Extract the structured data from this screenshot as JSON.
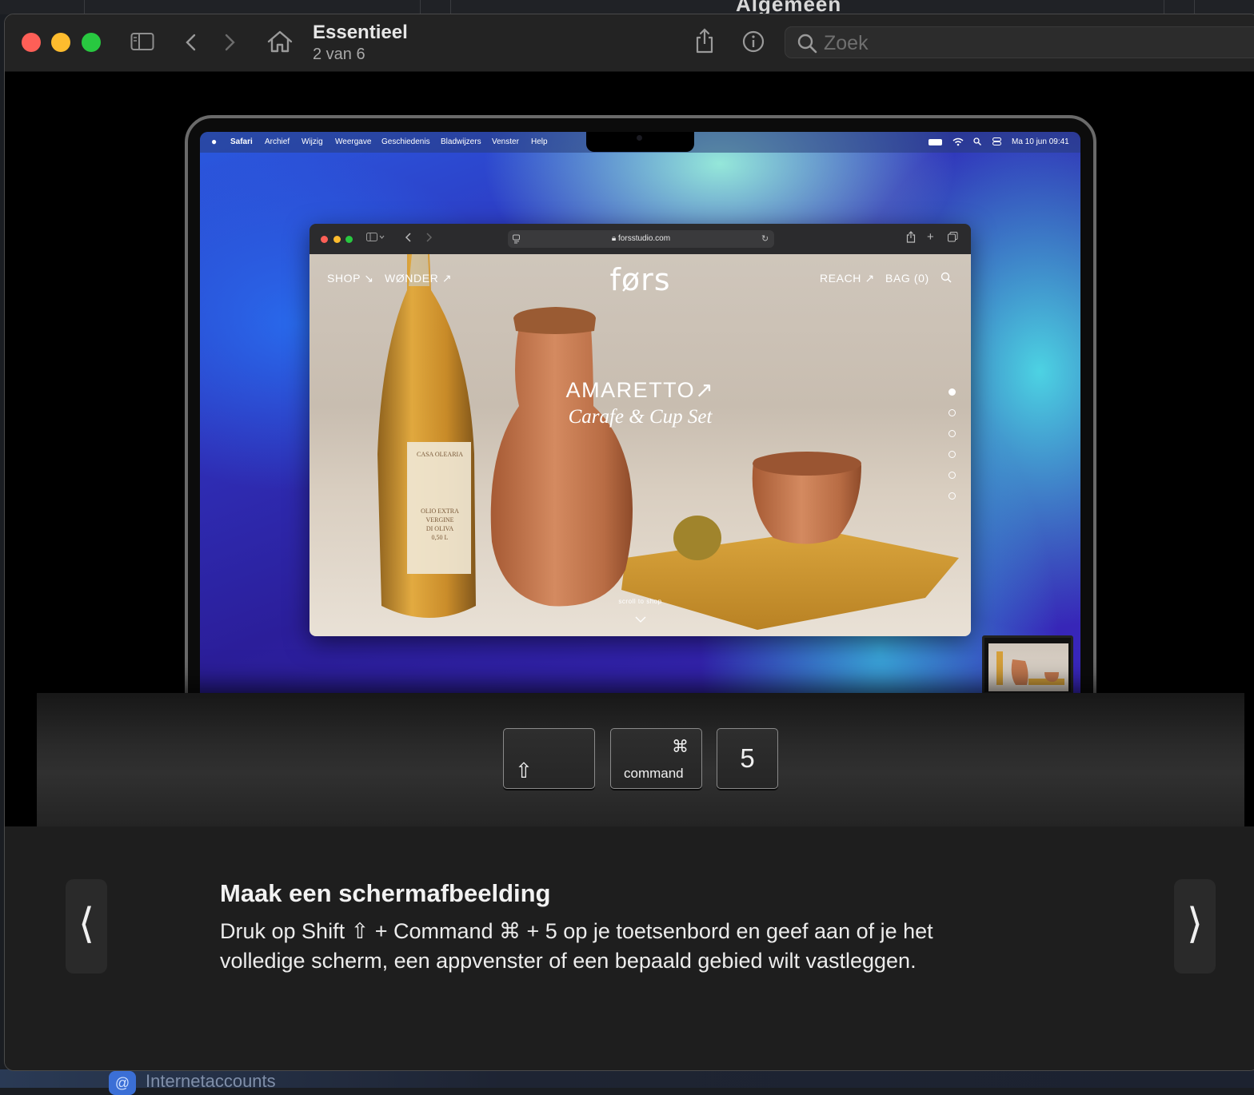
{
  "window": {
    "title": "Essentieel",
    "subtitle": "2 van 6",
    "search_placeholder": "Zoek"
  },
  "background": {
    "top_title_fragment": "Algemeen",
    "bottom_item": "Internetaccounts"
  },
  "mac_menubar": {
    "items": [
      "Safari",
      "Archief",
      "Wijzig",
      "Weergave",
      "Geschiedenis",
      "Bladwijzers",
      "Venster",
      "Help"
    ],
    "datetime": "Ma 10 jun 09:41"
  },
  "safari": {
    "url": "forsstudio.com"
  },
  "site": {
    "nav_left": [
      "SHOP ↘",
      "WØNDER ↗"
    ],
    "logo": "førs",
    "nav_right": [
      "REACH ↗",
      "BAG (0)"
    ],
    "hero_title": "AMARETTO↗",
    "hero_subtitle": "Carafe & Cup Set",
    "scroll_label": "scroll to shop",
    "bottle_label": [
      "CASA OLEARIA",
      "OLIO EXTRA",
      "VERGINE",
      "DI OLIVA",
      "0,50 L"
    ],
    "pager_count": 6,
    "pager_active": 1
  },
  "keys": {
    "shift_symbol": "⇧",
    "command_symbol": "⌘",
    "command_label": "command",
    "five": "5"
  },
  "info": {
    "title": "Maak een schermafbeelding",
    "body": "Druk op Shift ⇧ + Command ⌘ + 5 op je toetsenbord en geef aan of je het volledige scherm, een appvenster of een bepaald gebied wilt vastleggen.",
    "prev_symbol": "⟨",
    "next_symbol": "⟩"
  },
  "colors": {
    "close": "#fe5f57",
    "minimize": "#febc2e",
    "zoom": "#28c840"
  }
}
